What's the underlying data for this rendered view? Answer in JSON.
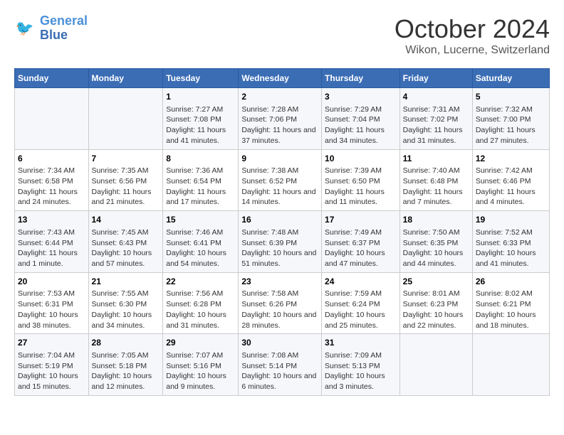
{
  "header": {
    "logo_line1": "General",
    "logo_line2": "Blue",
    "month": "October 2024",
    "location": "Wikon, Lucerne, Switzerland"
  },
  "days_of_week": [
    "Sunday",
    "Monday",
    "Tuesday",
    "Wednesday",
    "Thursday",
    "Friday",
    "Saturday"
  ],
  "weeks": [
    [
      {
        "day": "",
        "sunrise": "",
        "sunset": "",
        "daylight": ""
      },
      {
        "day": "",
        "sunrise": "",
        "sunset": "",
        "daylight": ""
      },
      {
        "day": "1",
        "sunrise": "Sunrise: 7:27 AM",
        "sunset": "Sunset: 7:08 PM",
        "daylight": "Daylight: 11 hours and 41 minutes."
      },
      {
        "day": "2",
        "sunrise": "Sunrise: 7:28 AM",
        "sunset": "Sunset: 7:06 PM",
        "daylight": "Daylight: 11 hours and 37 minutes."
      },
      {
        "day": "3",
        "sunrise": "Sunrise: 7:29 AM",
        "sunset": "Sunset: 7:04 PM",
        "daylight": "Daylight: 11 hours and 34 minutes."
      },
      {
        "day": "4",
        "sunrise": "Sunrise: 7:31 AM",
        "sunset": "Sunset: 7:02 PM",
        "daylight": "Daylight: 11 hours and 31 minutes."
      },
      {
        "day": "5",
        "sunrise": "Sunrise: 7:32 AM",
        "sunset": "Sunset: 7:00 PM",
        "daylight": "Daylight: 11 hours and 27 minutes."
      }
    ],
    [
      {
        "day": "6",
        "sunrise": "Sunrise: 7:34 AM",
        "sunset": "Sunset: 6:58 PM",
        "daylight": "Daylight: 11 hours and 24 minutes."
      },
      {
        "day": "7",
        "sunrise": "Sunrise: 7:35 AM",
        "sunset": "Sunset: 6:56 PM",
        "daylight": "Daylight: 11 hours and 21 minutes."
      },
      {
        "day": "8",
        "sunrise": "Sunrise: 7:36 AM",
        "sunset": "Sunset: 6:54 PM",
        "daylight": "Daylight: 11 hours and 17 minutes."
      },
      {
        "day": "9",
        "sunrise": "Sunrise: 7:38 AM",
        "sunset": "Sunset: 6:52 PM",
        "daylight": "Daylight: 11 hours and 14 minutes."
      },
      {
        "day": "10",
        "sunrise": "Sunrise: 7:39 AM",
        "sunset": "Sunset: 6:50 PM",
        "daylight": "Daylight: 11 hours and 11 minutes."
      },
      {
        "day": "11",
        "sunrise": "Sunrise: 7:40 AM",
        "sunset": "Sunset: 6:48 PM",
        "daylight": "Daylight: 11 hours and 7 minutes."
      },
      {
        "day": "12",
        "sunrise": "Sunrise: 7:42 AM",
        "sunset": "Sunset: 6:46 PM",
        "daylight": "Daylight: 11 hours and 4 minutes."
      }
    ],
    [
      {
        "day": "13",
        "sunrise": "Sunrise: 7:43 AM",
        "sunset": "Sunset: 6:44 PM",
        "daylight": "Daylight: 11 hours and 1 minute."
      },
      {
        "day": "14",
        "sunrise": "Sunrise: 7:45 AM",
        "sunset": "Sunset: 6:43 PM",
        "daylight": "Daylight: 10 hours and 57 minutes."
      },
      {
        "day": "15",
        "sunrise": "Sunrise: 7:46 AM",
        "sunset": "Sunset: 6:41 PM",
        "daylight": "Daylight: 10 hours and 54 minutes."
      },
      {
        "day": "16",
        "sunrise": "Sunrise: 7:48 AM",
        "sunset": "Sunset: 6:39 PM",
        "daylight": "Daylight: 10 hours and 51 minutes."
      },
      {
        "day": "17",
        "sunrise": "Sunrise: 7:49 AM",
        "sunset": "Sunset: 6:37 PM",
        "daylight": "Daylight: 10 hours and 47 minutes."
      },
      {
        "day": "18",
        "sunrise": "Sunrise: 7:50 AM",
        "sunset": "Sunset: 6:35 PM",
        "daylight": "Daylight: 10 hours and 44 minutes."
      },
      {
        "day": "19",
        "sunrise": "Sunrise: 7:52 AM",
        "sunset": "Sunset: 6:33 PM",
        "daylight": "Daylight: 10 hours and 41 minutes."
      }
    ],
    [
      {
        "day": "20",
        "sunrise": "Sunrise: 7:53 AM",
        "sunset": "Sunset: 6:31 PM",
        "daylight": "Daylight: 10 hours and 38 minutes."
      },
      {
        "day": "21",
        "sunrise": "Sunrise: 7:55 AM",
        "sunset": "Sunset: 6:30 PM",
        "daylight": "Daylight: 10 hours and 34 minutes."
      },
      {
        "day": "22",
        "sunrise": "Sunrise: 7:56 AM",
        "sunset": "Sunset: 6:28 PM",
        "daylight": "Daylight: 10 hours and 31 minutes."
      },
      {
        "day": "23",
        "sunrise": "Sunrise: 7:58 AM",
        "sunset": "Sunset: 6:26 PM",
        "daylight": "Daylight: 10 hours and 28 minutes."
      },
      {
        "day": "24",
        "sunrise": "Sunrise: 7:59 AM",
        "sunset": "Sunset: 6:24 PM",
        "daylight": "Daylight: 10 hours and 25 minutes."
      },
      {
        "day": "25",
        "sunrise": "Sunrise: 8:01 AM",
        "sunset": "Sunset: 6:23 PM",
        "daylight": "Daylight: 10 hours and 22 minutes."
      },
      {
        "day": "26",
        "sunrise": "Sunrise: 8:02 AM",
        "sunset": "Sunset: 6:21 PM",
        "daylight": "Daylight: 10 hours and 18 minutes."
      }
    ],
    [
      {
        "day": "27",
        "sunrise": "Sunrise: 7:04 AM",
        "sunset": "Sunset: 5:19 PM",
        "daylight": "Daylight: 10 hours and 15 minutes."
      },
      {
        "day": "28",
        "sunrise": "Sunrise: 7:05 AM",
        "sunset": "Sunset: 5:18 PM",
        "daylight": "Daylight: 10 hours and 12 minutes."
      },
      {
        "day": "29",
        "sunrise": "Sunrise: 7:07 AM",
        "sunset": "Sunset: 5:16 PM",
        "daylight": "Daylight: 10 hours and 9 minutes."
      },
      {
        "day": "30",
        "sunrise": "Sunrise: 7:08 AM",
        "sunset": "Sunset: 5:14 PM",
        "daylight": "Daylight: 10 hours and 6 minutes."
      },
      {
        "day": "31",
        "sunrise": "Sunrise: 7:09 AM",
        "sunset": "Sunset: 5:13 PM",
        "daylight": "Daylight: 10 hours and 3 minutes."
      },
      {
        "day": "",
        "sunrise": "",
        "sunset": "",
        "daylight": ""
      },
      {
        "day": "",
        "sunrise": "",
        "sunset": "",
        "daylight": ""
      }
    ]
  ]
}
